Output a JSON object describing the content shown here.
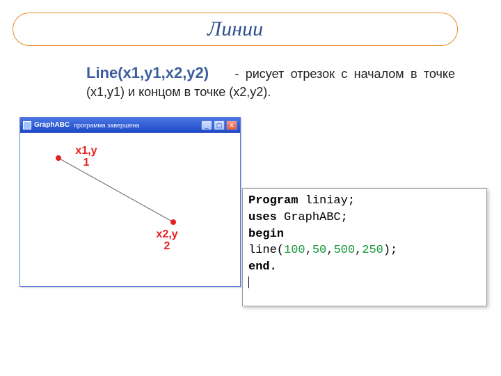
{
  "title": "Линии",
  "description": {
    "func": "Line(x1,y1,x2,y2)",
    "text": "- рисует отрезок с началом в точке (x1,y1) и концом в точке (x2,y2)."
  },
  "graph_window": {
    "app_name": "GraphABC",
    "subtitle": "программа завершена",
    "btn_min": "_",
    "btn_max": "▢",
    "btn_close": "X",
    "p1_label_l1": "x1,y",
    "p1_label_l2": "1",
    "p2_label_l1": "x2,y",
    "p2_label_l2": "2"
  },
  "code": {
    "kw_program": "Program",
    "prog_name": " liniay;",
    "kw_uses": "uses",
    "uses_name": " GraphABC;",
    "kw_begin": "begin",
    "line_call_a": "line(",
    "n1": "100",
    "c": ",",
    "n2": "50",
    "n3": "500",
    "n4": "250",
    "line_call_b": ");",
    "kw_end": "end."
  }
}
